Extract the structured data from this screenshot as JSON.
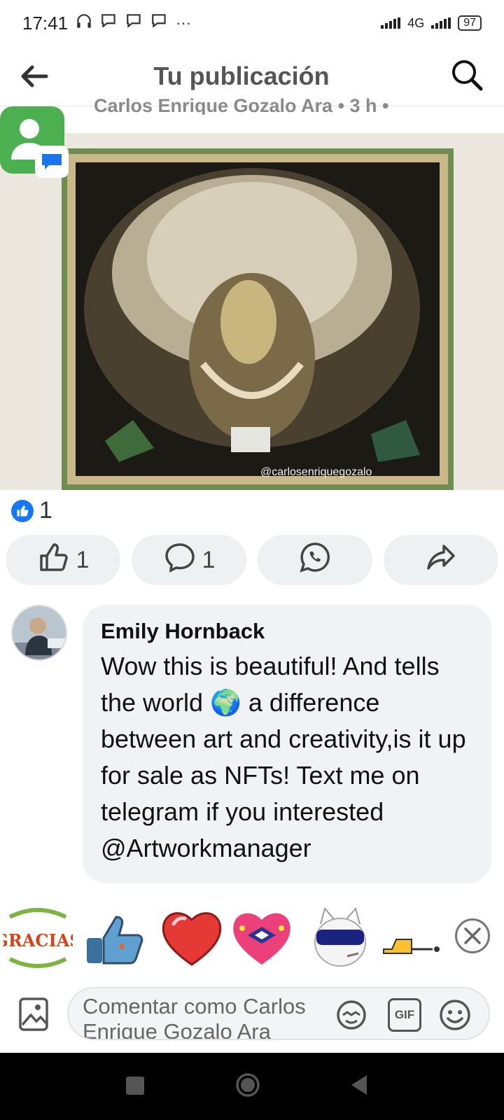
{
  "status_bar": {
    "time": "17:41",
    "network": "4G",
    "battery": "97",
    "more": "···"
  },
  "header": {
    "title": "Tu publicación"
  },
  "post": {
    "author_line": "Carlos Enrique Gozalo Ara  •  3 h  •",
    "watermark": "@carlosenriquegozalo"
  },
  "reactions": {
    "count": "1"
  },
  "actions": {
    "like_count": "1",
    "comment_count": "1"
  },
  "comment": {
    "author": "Emily Hornback",
    "text": "Wow this is beautiful! And tells the world 🌍 a difference between art and creativity,is it up for sale as NFTs! Text me on telegram if you interested @Artworkmanager"
  },
  "stickers": {
    "gracias_text": "GRACIAS"
  },
  "composer": {
    "placeholder": "Comentar como Carlos Enrique Gozalo Ara",
    "gif_label": "GIF"
  },
  "colors": {
    "brand_blue": "#1877f2",
    "pill_bg": "#eff0f2",
    "bubble_bg": "#f0f2f5"
  }
}
